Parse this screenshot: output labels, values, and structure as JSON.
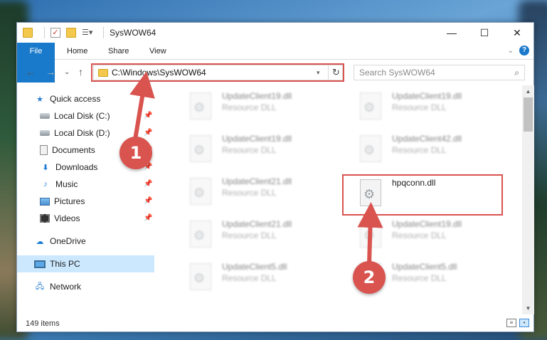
{
  "window": {
    "title": "SysWOW64",
    "controls": {
      "minimize": "—",
      "maximize": "☐",
      "close": "✕"
    }
  },
  "ribbon": {
    "tabs": [
      "File",
      "Home",
      "Share",
      "View"
    ],
    "help": "?",
    "collapse": "⌄"
  },
  "nav": {
    "back": "←",
    "forward": "→",
    "recent": "⌄",
    "up": "↑",
    "address": "C:\\Windows\\SysWOW64",
    "address_dropdown": "▾",
    "refresh": "↻",
    "search_placeholder": "Search SysWOW64",
    "search_icon": "search-icon"
  },
  "sidebar": {
    "items": [
      {
        "label": "Quick access",
        "icon": "star-icon",
        "pinned": false
      },
      {
        "label": "Local Disk (C:)",
        "icon": "disk-icon",
        "pinned": true
      },
      {
        "label": "Local Disk (D:)",
        "icon": "disk-icon",
        "pinned": true
      },
      {
        "label": "Documents",
        "icon": "document-icon",
        "pinned": true
      },
      {
        "label": "Downloads",
        "icon": "download-icon",
        "pinned": true
      },
      {
        "label": "Music",
        "icon": "music-icon",
        "pinned": true
      },
      {
        "label": "Pictures",
        "icon": "pictures-icon",
        "pinned": true
      },
      {
        "label": "Videos",
        "icon": "videos-icon",
        "pinned": true
      },
      {
        "label": "OneDrive",
        "icon": "cloud-icon",
        "pinned": false
      },
      {
        "label": "This PC",
        "icon": "computer-icon",
        "pinned": false,
        "selected": true
      },
      {
        "label": "Network",
        "icon": "network-icon",
        "pinned": false
      }
    ],
    "pin_glyph": "📌"
  },
  "files": [
    {
      "name": "UpdateClient19.dll",
      "type": "Resource DLL"
    },
    {
      "name": "UpdateClient19.dll",
      "type": "Resource DLL"
    },
    {
      "name": "UpdateClient19.dll",
      "type": "Resource DLL"
    },
    {
      "name": "UpdateClient42.dll",
      "type": "Resource DLL"
    },
    {
      "name": "UpdateClient21.dll",
      "type": "Resource DLL"
    },
    {
      "name": "hpqconn.dll",
      "type": ""
    },
    {
      "name": "UpdateClient21.dll",
      "type": "Resource DLL"
    },
    {
      "name": "UpdateClient19.dll",
      "type": "Resource DLL"
    },
    {
      "name": "UpdateClient5.dll",
      "type": "Resource DLL"
    },
    {
      "name": "UpdateClient5.dll",
      "type": "Resource DLL"
    }
  ],
  "status": {
    "count": "149 items"
  },
  "annotations": {
    "step1": "1",
    "step2": "2",
    "color": "#d9534f"
  }
}
